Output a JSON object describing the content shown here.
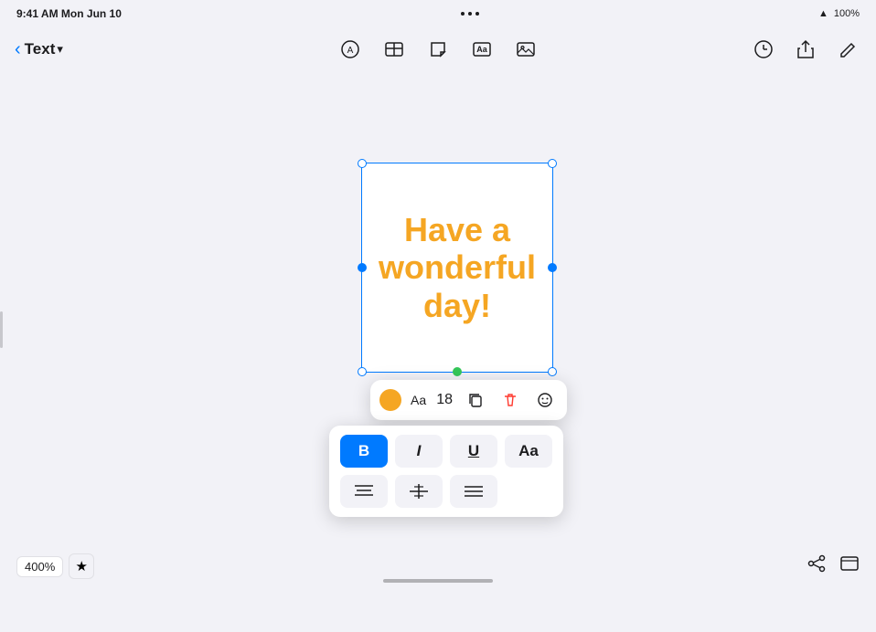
{
  "status_bar": {
    "time": "9:41 AM  Mon Jun 10",
    "wifi": "📶",
    "battery": "100%"
  },
  "toolbar": {
    "back_label": "",
    "title": "Text",
    "title_chevron": "▾",
    "center_icons": [
      "Ⓐ",
      "▭",
      "⬚",
      "Ⓐ",
      "⬚"
    ],
    "right_icons": [
      "⏱",
      "⬆",
      "✎"
    ]
  },
  "canvas": {
    "text_content": "Have a wonderful day!",
    "text_color": "#f5a623"
  },
  "float_toolbar": {
    "color": "#f5a623",
    "font_label": "Aa",
    "size": "18",
    "copy_icon": "⧉",
    "delete_icon": "🗑",
    "emoji_icon": "☺"
  },
  "format_popup": {
    "bold_label": "B",
    "italic_label": "I",
    "underline_label": "U",
    "font_label": "Aa",
    "align_left": "≡",
    "center_star": "✳",
    "list": "☰"
  },
  "bottom_bar": {
    "zoom": "400%",
    "star_icon": "★",
    "graph_icon": "⌁",
    "window_icon": "▢"
  }
}
